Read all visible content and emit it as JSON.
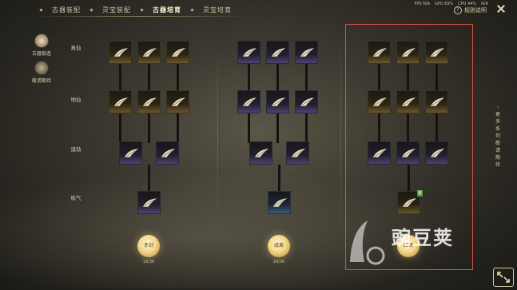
{
  "tabs": [
    {
      "label": "古器装配",
      "active": false
    },
    {
      "label": "灵宝装配",
      "active": false
    },
    {
      "label": "古器培育",
      "active": true
    },
    {
      "label": "灵宝培育",
      "active": false
    }
  ],
  "stats": {
    "fps": "FPS N/A",
    "gpu": "GPU 69%",
    "cpu": "CPU 44%",
    "extra": "N/A"
  },
  "rules_label": "规则说明",
  "side_menu": [
    {
      "label": "古器锻造",
      "icon": "forge-icon"
    },
    {
      "label": "敬请期待",
      "icon": "lock-icon"
    }
  ],
  "ranks": [
    "真仙",
    "地仙",
    "道劫",
    "练气"
  ],
  "bottom_items": [
    {
      "coin_label": "赤剑",
      "count": "18/36"
    },
    {
      "coin_label": "戚离",
      "count": "18/36"
    },
    {
      "coin_label": "四哥",
      "count": ""
    }
  ],
  "slot_badge": "装",
  "vertical_note": "更多系列敬请期待",
  "watermark_text": "豌豆荚",
  "colors": {
    "gold": "#c9a24a",
    "purple": "#4d4276",
    "blue": "#3b5a7e",
    "highlight": "#e24a42"
  }
}
